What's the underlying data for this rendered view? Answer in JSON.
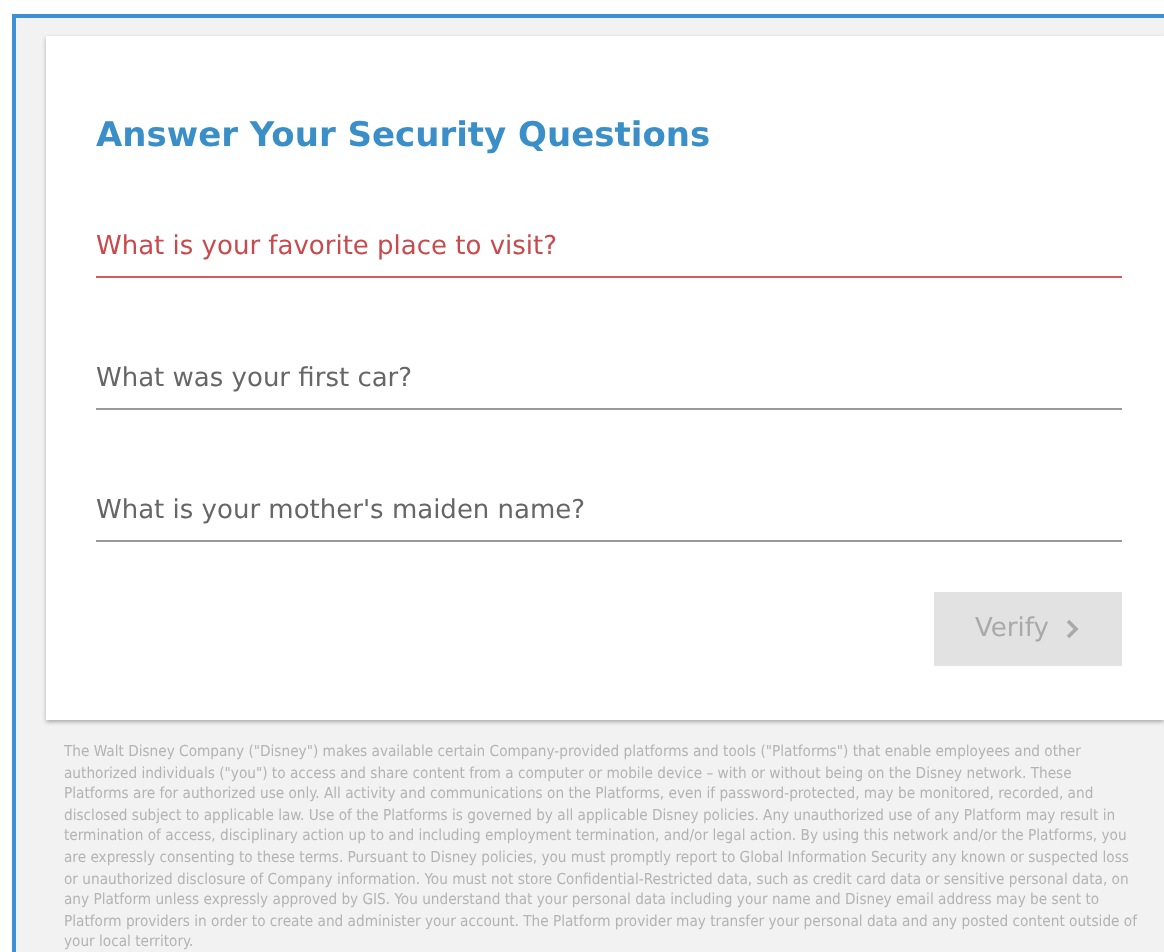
{
  "title": "Answer Your Security Questions",
  "questions": [
    {
      "placeholder": "What is your favorite place to visit?",
      "invalid": true
    },
    {
      "placeholder": "What was your first car?",
      "invalid": false
    },
    {
      "placeholder": "What is your mother's maiden name?",
      "invalid": false
    }
  ],
  "verify_button": {
    "label": "Verify",
    "disabled": true
  },
  "disclaimer": "The Walt Disney Company (\"Disney\") makes available certain Company-provided platforms and tools (\"Platforms\") that enable employees and other authorized individuals (\"you\") to access and share content from a computer or mobile device – with or without being on the Disney network. These Platforms are for authorized use only. All activity and communications on the Platforms, even if password-protected, may be monitored, recorded, and disclosed subject to applicable law. Use of the Platforms is governed by all applicable Disney policies. Any unauthorized use of any Platform may result in termination of access, disciplinary action up to and including employment termination, and/or legal action. By using this network and/or the Platforms, you are expressly consenting to these terms. Pursuant to Disney policies, you must promptly report to Global Information Security any known or suspected loss or unauthorized disclosure of Company information. You must not store Confidential-Restricted data, such as credit card data or sensitive personal data, on any Platform unless expressly approved by GIS. You understand that your personal data including your name and Disney email address may be sent to Platform providers in order to create and administer your account. The Platform provider may transfer your personal data and any posted content outside of your local territory."
}
